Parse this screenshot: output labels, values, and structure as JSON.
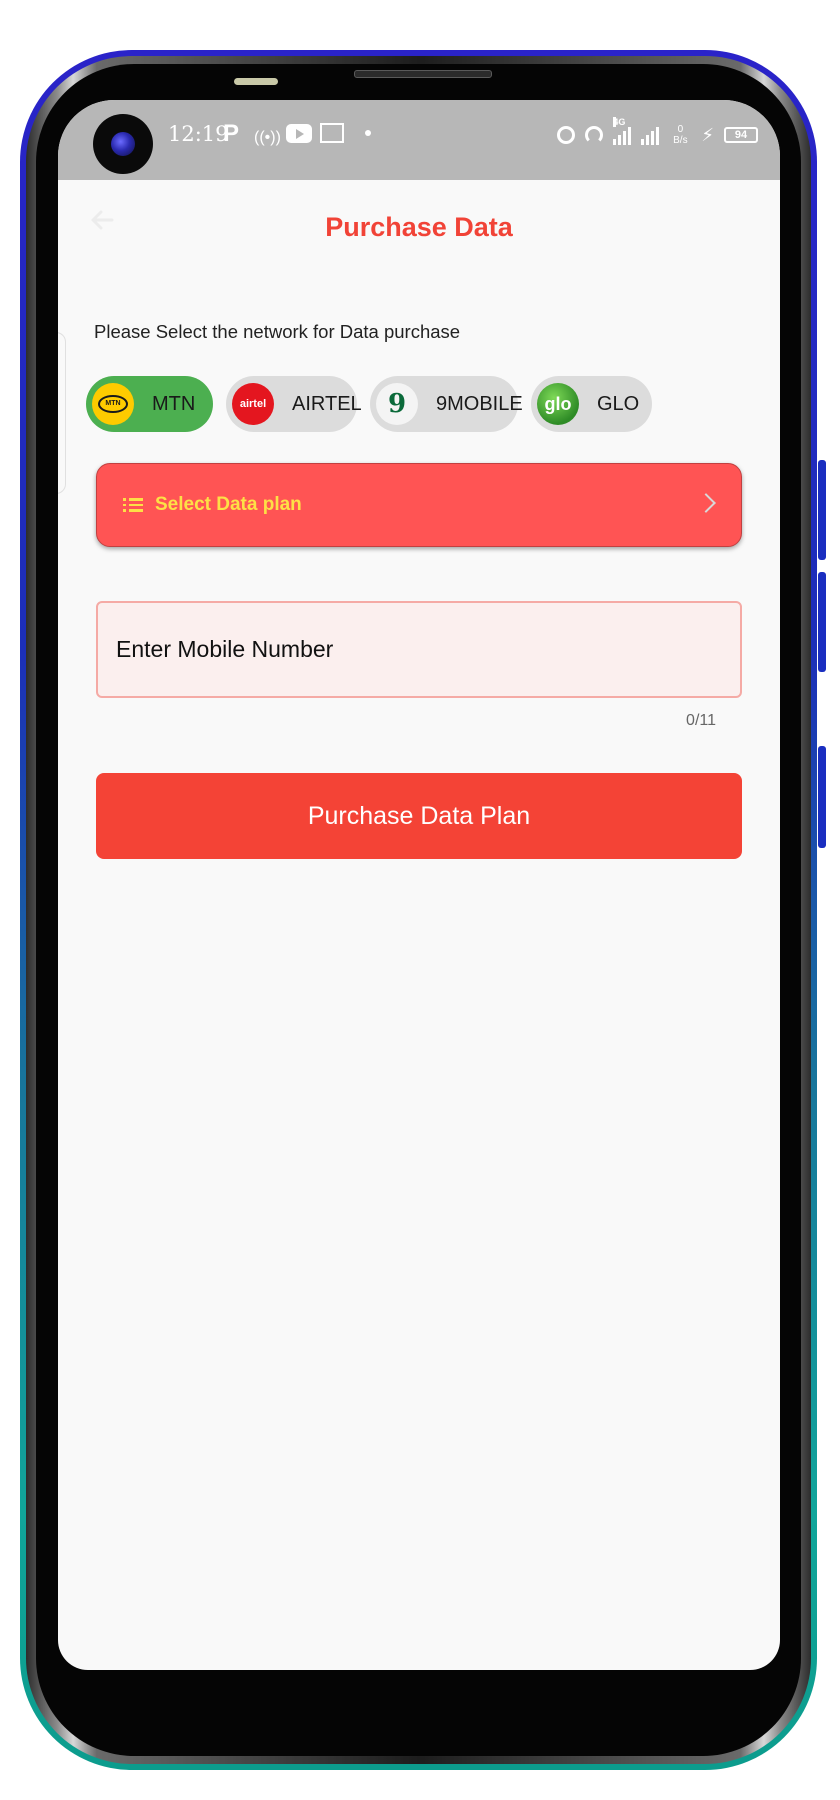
{
  "status_bar": {
    "time": "12:19",
    "icons": [
      "parking-icon",
      "radio-icon",
      "youtube-icon",
      "mail-icon",
      "alarm-icon",
      "hotspot-icon",
      "signal-4g-icon",
      "signal-icon",
      "charging-icon",
      "battery-icon"
    ],
    "net_type": "4G",
    "net_speed_value": "0",
    "net_speed_unit": "B/s",
    "battery": "94"
  },
  "header": {
    "title": "Purchase Data"
  },
  "instruction": "Please Select the network for Data purchase",
  "networks": [
    {
      "label": "MTN",
      "selected": true,
      "logo_text": "MTN"
    },
    {
      "label": "AIRTEL",
      "selected": false,
      "logo_text": "airtel"
    },
    {
      "label": "9MOBILE",
      "selected": false,
      "logo_text": "9"
    },
    {
      "label": "GLO",
      "selected": false,
      "logo_text": "glo"
    }
  ],
  "data_plan": {
    "label": "Select Data plan"
  },
  "mobile": {
    "placeholder": "Enter Mobile Number",
    "value": "",
    "counter": "0/11"
  },
  "purchase_button": {
    "label": "Purchase Data Plan"
  },
  "colors": {
    "accent": "#f14337",
    "plan_button": "#ff5454",
    "plan_text": "#fde046",
    "selected_chip": "#4caf50",
    "chip": "#dcdcdc",
    "status_bar": "#b7b7b7"
  }
}
